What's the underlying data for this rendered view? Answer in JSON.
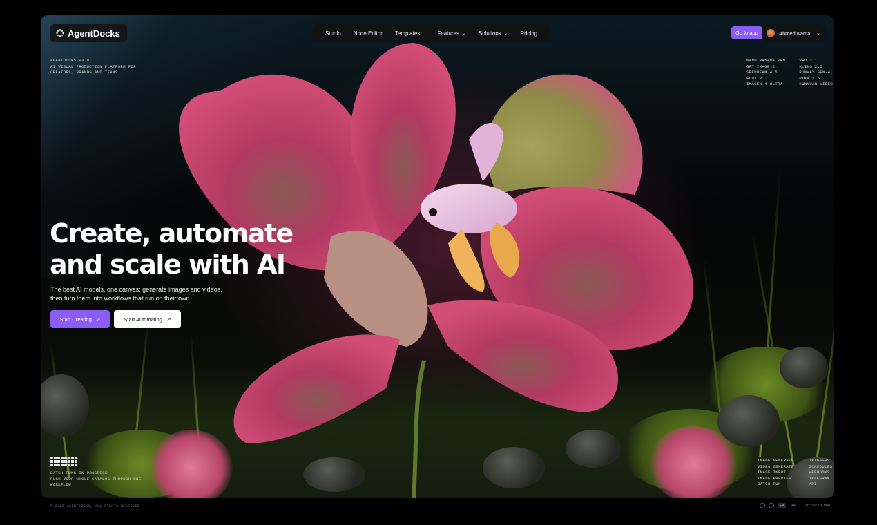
{
  "brand": {
    "name": "AgentDocks",
    "logo_icon": "sparkle-dots-icon"
  },
  "nav": {
    "items": [
      {
        "label": "Studio",
        "has_dropdown": false
      },
      {
        "label": "Node Editor",
        "has_dropdown": false
      },
      {
        "label": "Templates",
        "has_dropdown": false
      },
      {
        "label": "Features",
        "has_dropdown": true
      },
      {
        "label": "Solutions",
        "has_dropdown": true
      },
      {
        "label": "Pricing",
        "has_dropdown": false
      }
    ]
  },
  "header_right": {
    "go_to_app": "Go to app",
    "user_name": "Ahmed Kamal"
  },
  "meta": {
    "line1": "AGENTDOCKS V3.0",
    "line2": "AI VISUAL PRODUCTION PLATFORM FOR",
    "line3": "CREATORS, BRANDS AND TEAMS"
  },
  "models": {
    "col1": [
      "NANO BANANA PRO",
      "GPT IMAGE 2",
      "SEEDREAM 4.5",
      "FLUX 2",
      "IMAGEN 4 ULTRA"
    ],
    "col2": [
      "VEO 3.1",
      "KLING 2.5",
      "RUNWAY GEN-4",
      "PIKA 2.5",
      "HUNYUAN VIDEO"
    ]
  },
  "hero": {
    "title_line1": "Create, automate",
    "title_line2": "and scale with AI",
    "subtitle_line1": "The best AI models, one canvas: generate images and videos,",
    "subtitle_line2": "then turn them into workflows that run on their own.",
    "primary_cta": "Start Creating",
    "secondary_cta": "Start Automating"
  },
  "batch": {
    "line1": "BATCH RUNS IN PROGRESS",
    "line2": "PUSH YOUR WHOLE CATALOG THROUGH ONE",
    "line3": "WORKFLOW"
  },
  "capabilities": {
    "col1": [
      "IMAGE GENERATE",
      "VIDEO GENERATE",
      "IMAGE INPUT",
      "IMAGE PREVIEW",
      "BATCH RUN"
    ],
    "col2": [
      "TRIGGERS",
      "SCHEDULES",
      "WEBHOOKS",
      "TELEGRAM",
      "API"
    ]
  },
  "footer": {
    "copyright": "© 2026 AGENTDOCKS, ALL RIGHTS RESERVED",
    "lang_en": "EN",
    "lang_ar": "AR",
    "time": "16:25:18 RGD"
  },
  "colors": {
    "accent": "#8b5cf6",
    "petal": "#c23d66",
    "background": "#000000"
  }
}
